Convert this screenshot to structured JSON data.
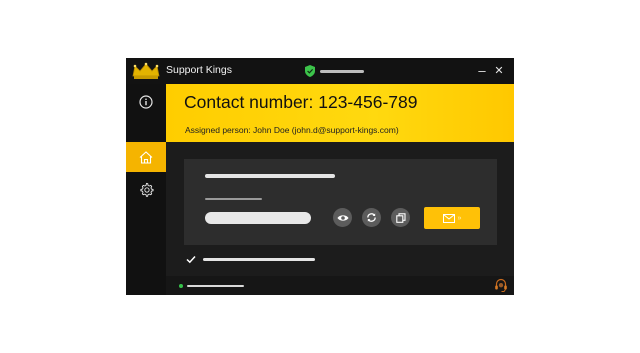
{
  "window": {
    "title": "Support Kings"
  },
  "titlebar": {
    "logo_icon": "crown-logo",
    "status_icon": "shield-check-icon",
    "minimize_glyph": "–",
    "close_glyph": "✕"
  },
  "sidebar": {
    "items": [
      {
        "icon": "info-icon",
        "active": false
      },
      {
        "icon": "home-icon",
        "active": true
      },
      {
        "icon": "gear-icon",
        "active": false
      }
    ]
  },
  "header": {
    "contact": "Contact number: 123-456-789",
    "assigned": "Assigned person: John Doe (john.d@support-kings.com)"
  },
  "card": {
    "actions": [
      "eye-icon",
      "refresh-icon",
      "copy-icon"
    ],
    "send_icon": "mail-icon",
    "send_arrow": "»"
  },
  "options": {
    "checkbox_checked": true
  },
  "statusbar": {
    "status_dot_color": "#36c24a",
    "support_icon": "headset-icon"
  },
  "colors": {
    "accent": "#ffcd00",
    "background": "#1c1c1c",
    "sidebar": "#111111"
  }
}
